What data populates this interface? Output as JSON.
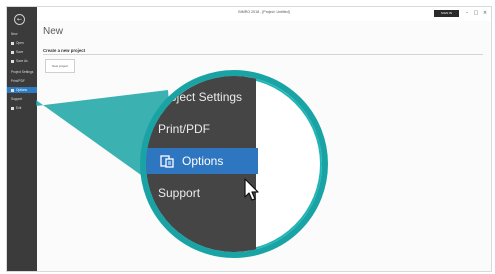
{
  "window": {
    "title": "BIMRO 2018 - [Project: Untitled]",
    "account_label": "SIGN IN",
    "minimize_glyph": "–",
    "maximize_glyph": "□",
    "close_glyph": "×"
  },
  "sidebar": {
    "back_glyph": "←",
    "items": [
      {
        "label": "New"
      },
      {
        "label": "Open"
      },
      {
        "label": "Save"
      },
      {
        "label": "Save As"
      },
      {
        "label": "Project Settings"
      },
      {
        "label": "Print/PDF"
      },
      {
        "label": "Options"
      },
      {
        "label": "Support"
      },
      {
        "label": "Exit"
      }
    ]
  },
  "main": {
    "title": "New",
    "section_heading": "Create a new project",
    "tile_label": "New project"
  },
  "magnifier": {
    "items": [
      {
        "label": "Project Settings"
      },
      {
        "label": "Print/PDF"
      },
      {
        "label": "Options"
      },
      {
        "label": "Support"
      }
    ],
    "active_index": 2,
    "accent_color": "#1aa3a5",
    "active_color": "#2f76c0"
  }
}
